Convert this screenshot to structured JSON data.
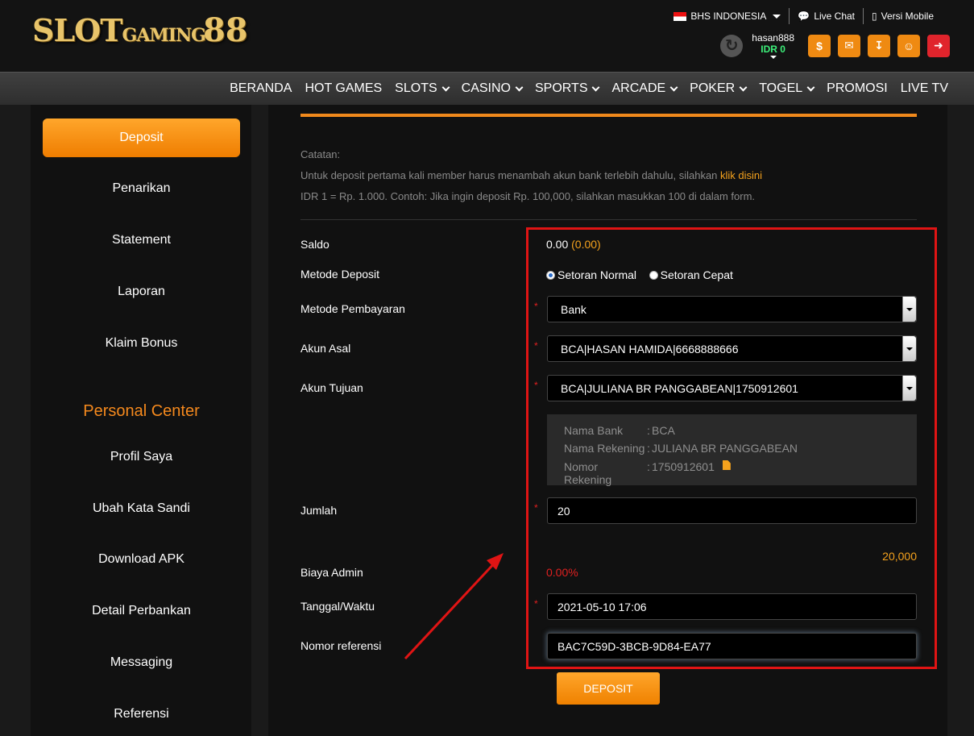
{
  "brand": {
    "part1": "SLOT",
    "part2": "GAMING",
    "part3": "88"
  },
  "top": {
    "language": "BHS INDONESIA",
    "live_chat": "Live Chat",
    "mobile": "Versi Mobile"
  },
  "user": {
    "name": "hasan888",
    "balance": "IDR 0"
  },
  "nav": [
    "BERANDA",
    "HOT GAMES",
    "SLOTS",
    "CASINO",
    "SPORTS",
    "ARCADE",
    "POKER",
    "TOGEL",
    "PROMOSI",
    "LIVE TV"
  ],
  "sidebar": {
    "items": [
      "Deposit",
      "Penarikan",
      "Statement",
      "Laporan",
      "Klaim Bonus"
    ],
    "personal_heading": "Personal Center",
    "personal_items": [
      "Profil Saya",
      "Ubah Kata Sandi",
      "Download APK",
      "Detail Perbankan",
      "Messaging",
      "Referensi"
    ]
  },
  "notes": {
    "heading": "Catatan:",
    "line1": "Untuk deposit pertama kali member harus menambah akun bank terlebih dahulu, silahkan ",
    "link": "klik disini",
    "line2": "IDR 1 = Rp. 1.000. Contoh: Jika ingin deposit Rp. 100,000, silahkan masukkan 100 di dalam form."
  },
  "form": {
    "saldo_label": "Saldo",
    "saldo_value": "0.00",
    "saldo_paren": "(0.00)",
    "metode_deposit_label": "Metode Deposit",
    "radio_normal": "Setoran Normal",
    "radio_cepat": "Setoran Cepat",
    "metode_pembayaran_label": "Metode Pembayaran",
    "metode_pembayaran_value": "Bank",
    "akun_asal_label": "Akun Asal",
    "akun_asal_value": "BCA|HASAN HAMIDA|6668888666",
    "akun_tujuan_label": "Akun Tujuan",
    "akun_tujuan_value": "BCA|JULIANA BR PANGGABEAN|1750912601",
    "bank_info": {
      "nama_bank_key": "Nama Bank",
      "nama_bank_val": "BCA",
      "nama_rek_key": "Nama Rekening",
      "nama_rek_val": "JULIANA BR PANGGABEAN",
      "nomor_rek_key": "Nomor Rekening",
      "nomor_rek_val": "1750912601",
      "colon": ":"
    },
    "jumlah_label": "Jumlah",
    "jumlah_value": "20",
    "jumlah_converted": "20,000",
    "biaya_label": "Biaya Admin",
    "biaya_value": "0.00%",
    "tanggal_label": "Tanggal/Waktu",
    "tanggal_value": "2021-05-10 17:06",
    "ref_label": "Nomor referensi",
    "ref_value": "BAC7C59D-3BCB-9D84-EA77",
    "required_mark": "*",
    "submit": "DEPOSIT"
  },
  "colors": {
    "accent": "#f0891c",
    "highlight": "#e01414",
    "balance": "#3df07a"
  }
}
